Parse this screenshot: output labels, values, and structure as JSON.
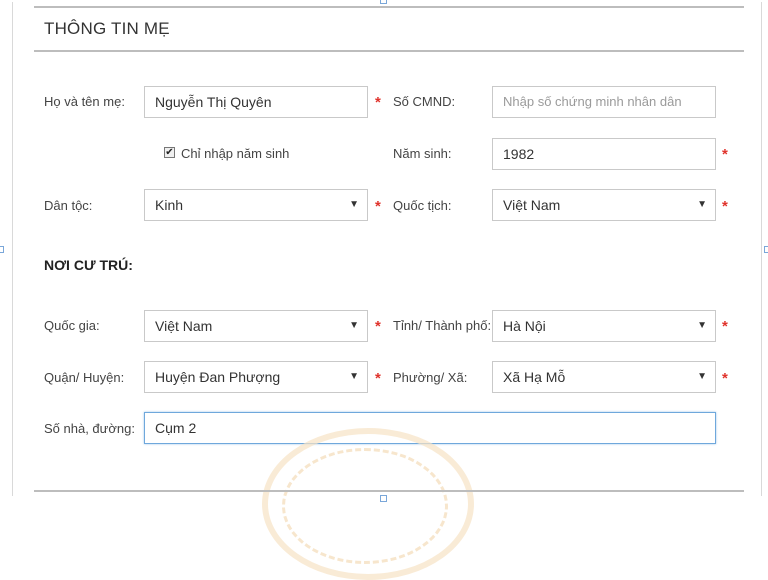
{
  "colors": {
    "required": "#e0322b",
    "focus_border": "#6fa8dc"
  },
  "header": {
    "title": "THÔNG TIN MẸ"
  },
  "mother": {
    "name_label": "Họ và tên mẹ:",
    "name_value": "Nguyễn Thị Quyên",
    "id_label": "Số CMND:",
    "id_placeholder": "Nhập số chứng minh nhân dân",
    "year_only_label": "Chỉ nhập năm sinh",
    "year_only_checked": true,
    "birth_year_label": "Năm sinh:",
    "birth_year_value": "1982",
    "ethnicity_label": "Dân tộc:",
    "ethnicity_value": "Kinh",
    "nationality_label": "Quốc tịch:",
    "nationality_value": "Việt Nam"
  },
  "residence": {
    "title": "NƠI CƯ TRÚ:",
    "country_label": "Quốc gia:",
    "country_value": "Việt Nam",
    "province_label": "Tỉnh/ Thành phố:",
    "province_value": "Hà Nội",
    "district_label": "Quận/ Huyện:",
    "district_value": "Huyện Đan Phượng",
    "ward_label": "Phường/ Xã:",
    "ward_value": "Xã Hạ Mỗ",
    "street_label": "Số nhà, đường:",
    "street_value": "Cụm 2"
  },
  "icons": {
    "required": "*",
    "dropdown": "▼",
    "check": "✔"
  }
}
